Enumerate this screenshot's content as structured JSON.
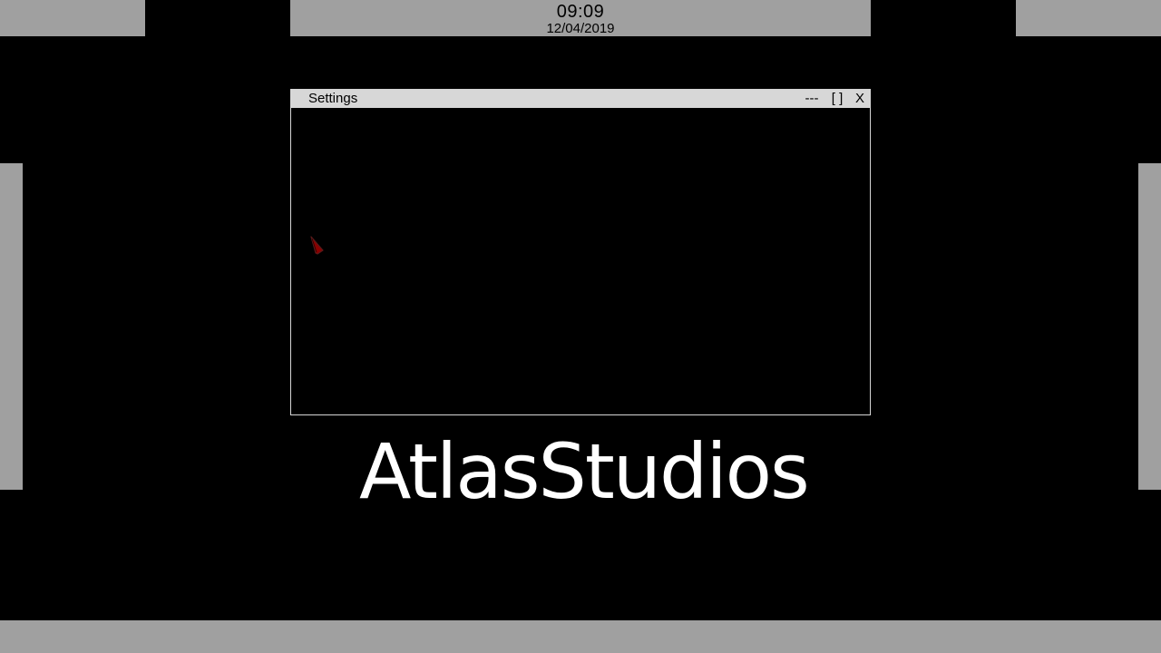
{
  "clock": {
    "time": "09:09",
    "date": "12/04/2019"
  },
  "window": {
    "title": "Settings",
    "minimize_label": "---",
    "maximize_label": "[ ]",
    "close_label": "X"
  },
  "logo": {
    "text": "AtlasStudios"
  },
  "colors": {
    "desktop_background": "#000000",
    "panel": "#a0a0a0",
    "titlebar": "#d7d7d7",
    "window_border": "#d6d6d6",
    "logo_text": "#ffffff",
    "cursor": "#8b0000"
  },
  "icons": {
    "cursor": "mouse-pointer-icon"
  }
}
